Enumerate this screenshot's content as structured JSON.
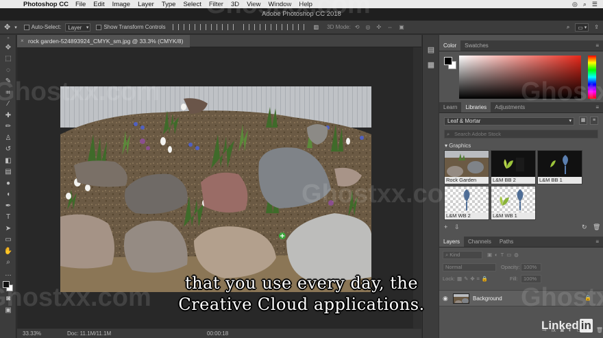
{
  "menubar": {
    "app_name": "Photoshop CC",
    "items": [
      "File",
      "Edit",
      "Image",
      "Layer",
      "Type",
      "Select",
      "Filter",
      "3D",
      "View",
      "Window",
      "Help"
    ]
  },
  "window": {
    "title": "Adobe Photoshop CC 2018"
  },
  "options_bar": {
    "auto_select_label": "Auto-Select:",
    "auto_select_target": "Layer",
    "show_transform_label": "Show Transform Controls",
    "mode_3d_label": "3D Mode:"
  },
  "document": {
    "tab_title": "rock garden-524893924_CMYK_sm.jpg @ 33.3% (CMYK/8)",
    "zoom": "33.33%",
    "doc_size": "Doc: 11.1M/11.1M",
    "timecode": "00:00:18"
  },
  "panels": {
    "color_tabs": [
      "Color",
      "Swatches"
    ],
    "library_tabs": [
      "Learn",
      "Libraries",
      "Adjustments"
    ],
    "library_name": "Leaf & Mortar",
    "library_search_placeholder": "Search Adobe Stock",
    "section_title": "Graphics",
    "graphics": [
      "Rock Garden",
      "L&M BB 2",
      "L&M BB 1",
      "L&M WB 2",
      "L&M WB 1"
    ],
    "layers_tabs": [
      "Layers",
      "Channels",
      "Paths"
    ],
    "layer_kind": "Kind",
    "blend_mode": "Normal",
    "opacity_label": "Opacity:",
    "opacity_value": "100%",
    "lock_label": "Lock:",
    "fill_label": "Fill:",
    "fill_value": "100%",
    "layers": [
      {
        "name": "Background"
      }
    ]
  },
  "subtitle": {
    "line1": "that you use every day, the",
    "line2": "Creative Cloud applications."
  },
  "brand": {
    "linkedin_text": "Linked",
    "linkedin_in": "in"
  },
  "watermark": {
    "text": "Ghostxx.com"
  },
  "colors": {
    "accent_red": "#e8281a",
    "panel_bg": "#535353",
    "ui_dark": "#323232"
  }
}
